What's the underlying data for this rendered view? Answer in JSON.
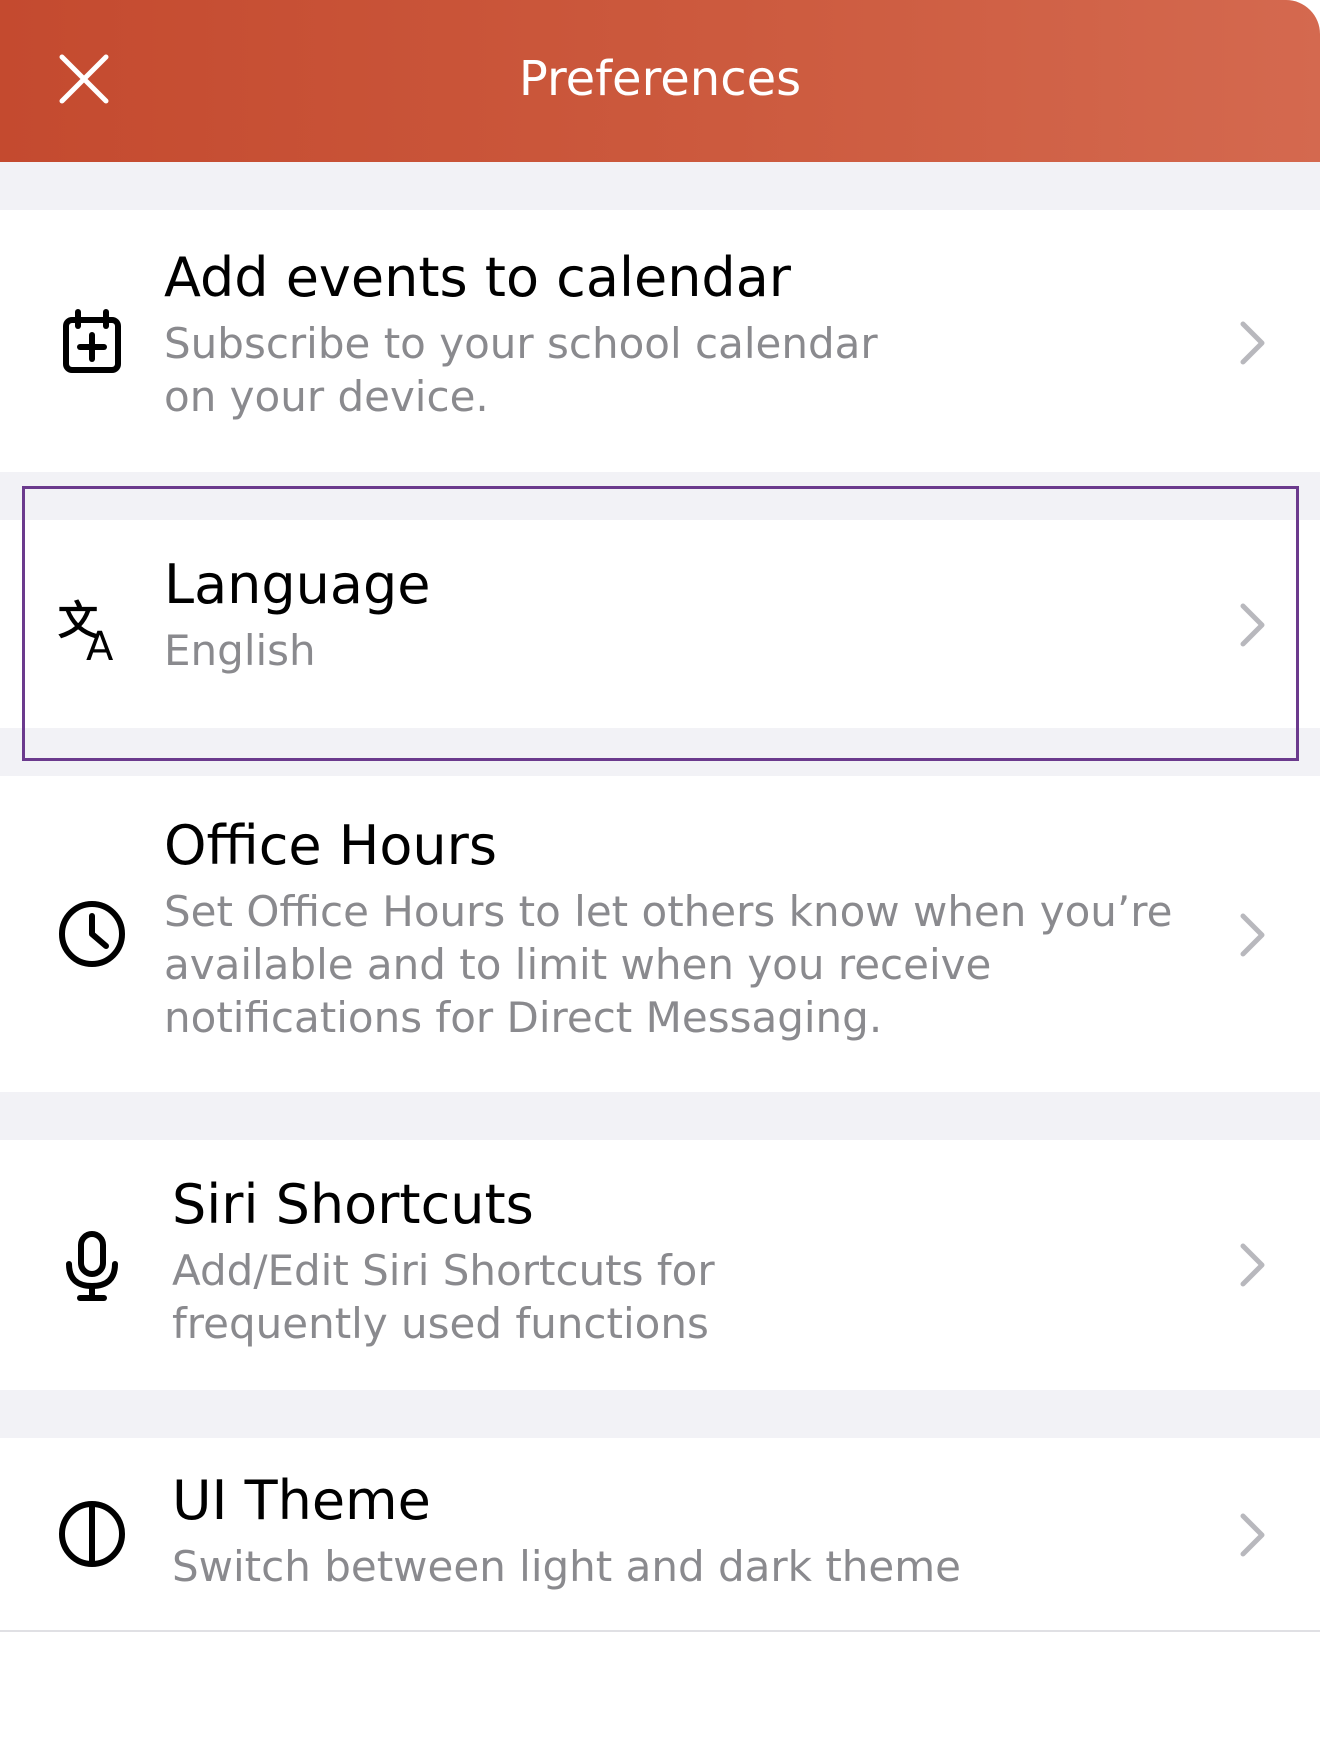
{
  "header": {
    "title": "Preferences",
    "background_color": "#c9543a",
    "close_icon": "close-icon"
  },
  "items": [
    {
      "title": "Add events to calendar",
      "subtitle": "Subscribe to your school calendar on your device.",
      "icon": "calendar-add-icon"
    },
    {
      "title": "Language",
      "subtitle": "English",
      "icon": "translate-icon",
      "highlighted": true
    },
    {
      "title": "Office Hours",
      "subtitle": "Set Office Hours to let others know when you’re available and to limit when you receive notifications for Direct Messaging.",
      "icon": "clock-icon"
    },
    {
      "title": "Siri Shortcuts",
      "subtitle": "Add/Edit Siri Shortcuts for frequently used functions",
      "icon": "microphone-icon"
    },
    {
      "title": "UI Theme",
      "subtitle": "Switch between light and dark theme",
      "icon": "half-circle-theme-icon"
    }
  ],
  "colors": {
    "highlight_border": "#6b3a8d",
    "section_gap": "#f2f2f6",
    "subtitle_text": "#8a8a8e"
  }
}
